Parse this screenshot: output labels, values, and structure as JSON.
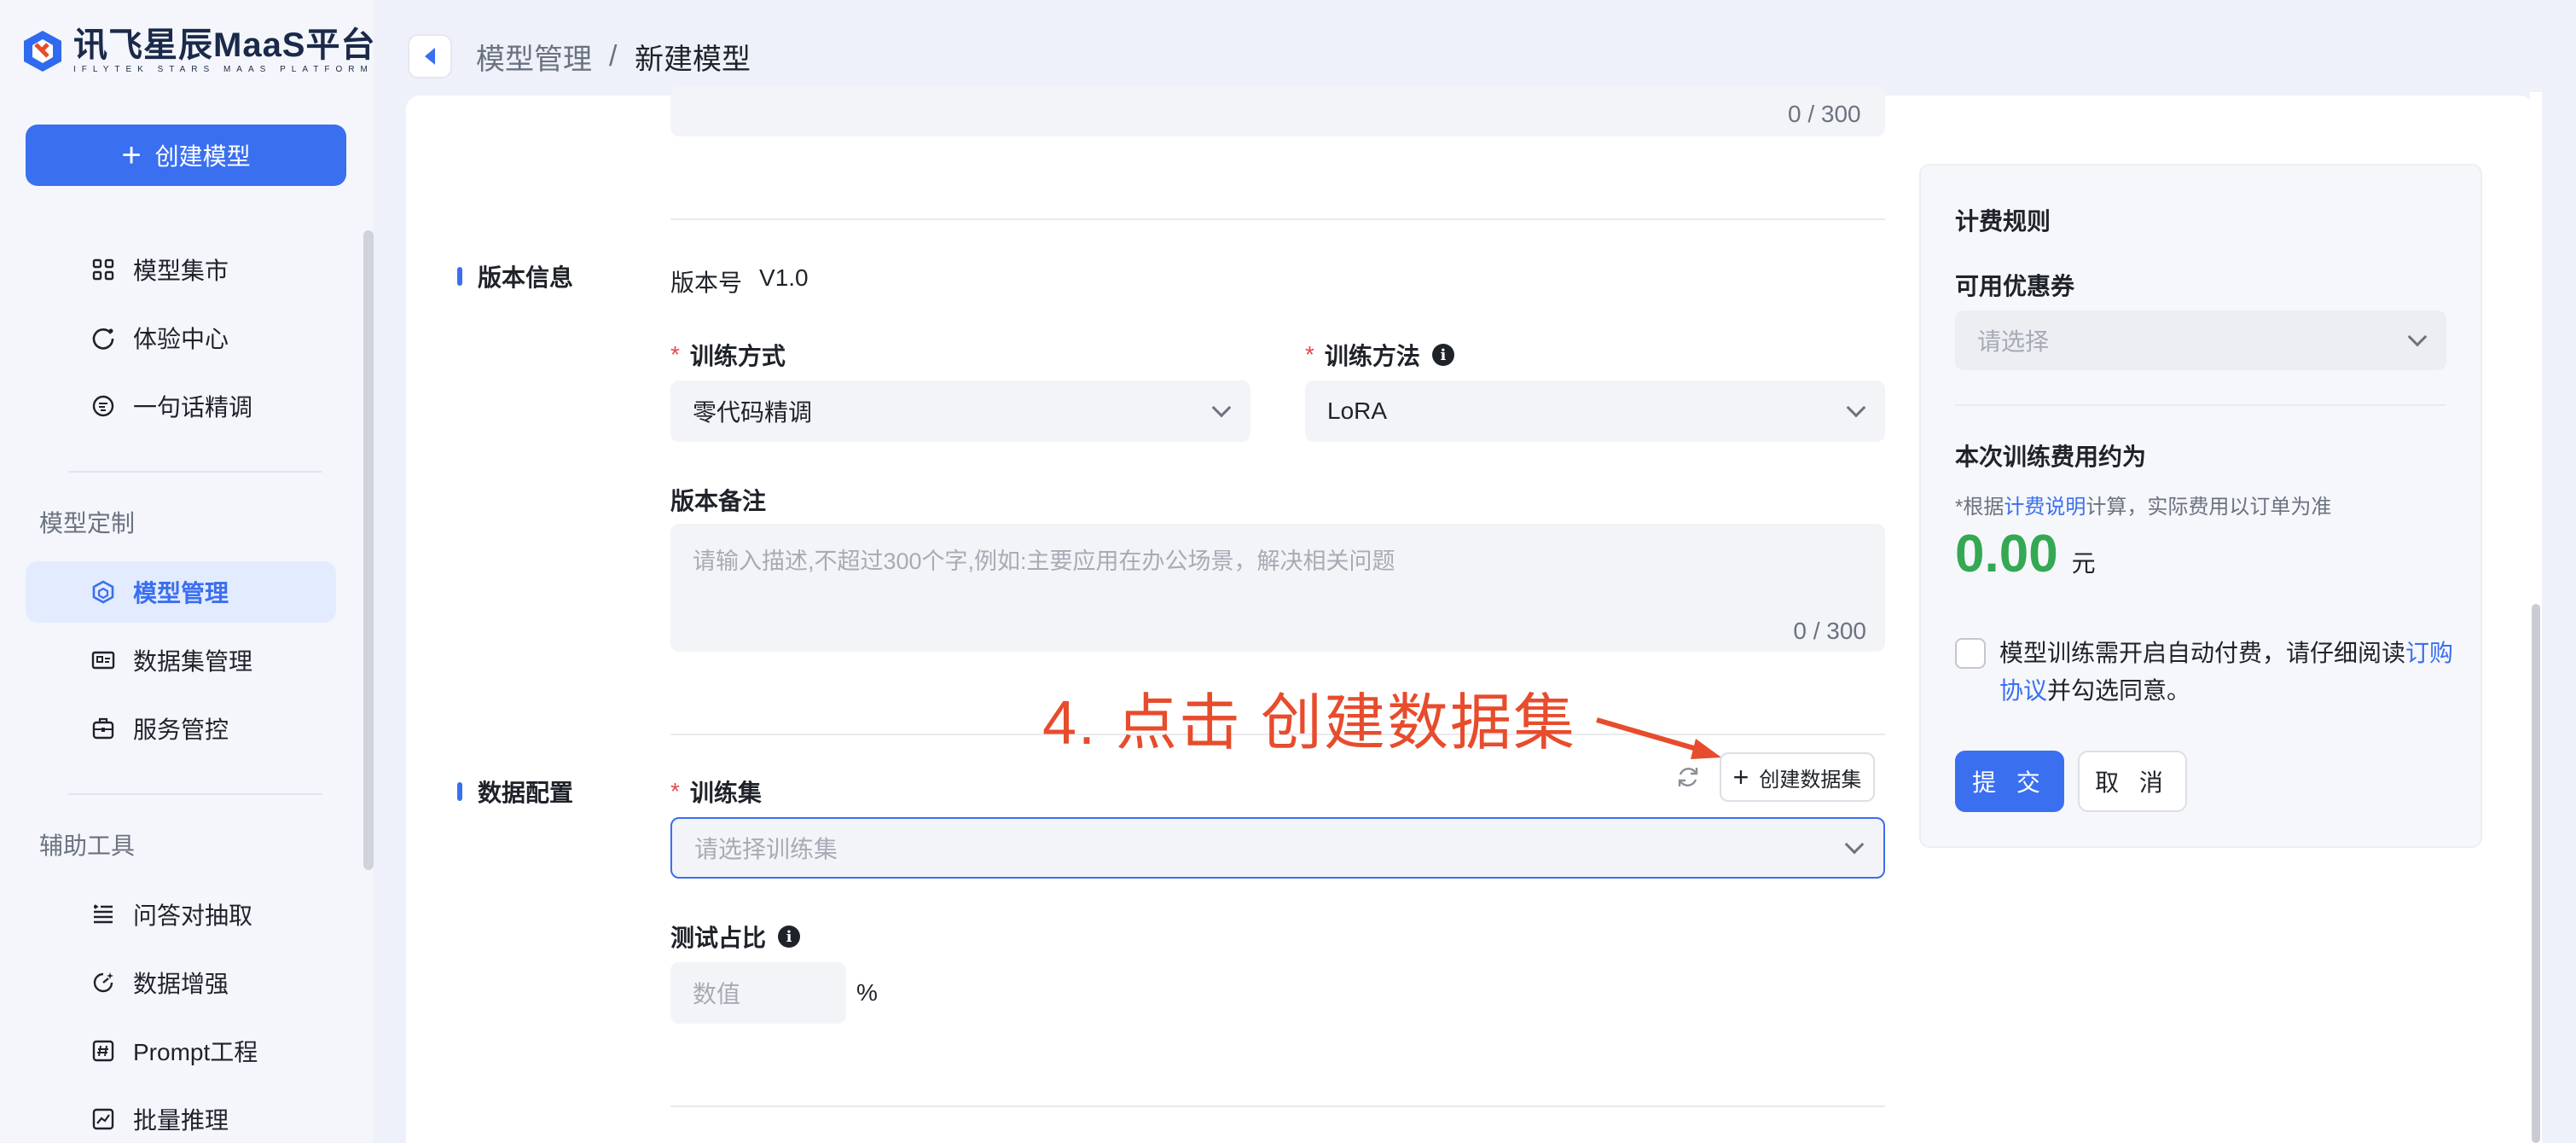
{
  "brand": {
    "title": "讯飞星辰MaaS平台",
    "subtitle": "IFLYTEK STARS MAAS PLATFORM"
  },
  "sidebar": {
    "create_button": "创建模型",
    "items_top": [
      {
        "label": "模型集市",
        "icon": "grid-icon"
      },
      {
        "label": "体验中心",
        "icon": "refresh-circle-icon"
      },
      {
        "label": "一句话精调",
        "icon": "chat-bubble-icon"
      }
    ],
    "section_custom": "模型定制",
    "items_custom": [
      {
        "label": "模型管理",
        "icon": "cube-icon",
        "active": true
      },
      {
        "label": "数据集管理",
        "icon": "dataset-icon"
      },
      {
        "label": "服务管控",
        "icon": "robot-icon"
      }
    ],
    "section_tools": "辅助工具",
    "items_tools": [
      {
        "label": "问答对抽取",
        "icon": "list-icon"
      },
      {
        "label": "数据增强",
        "icon": "sparkle-gauge-icon"
      },
      {
        "label": "Prompt工程",
        "icon": "hash-icon"
      },
      {
        "label": "批量推理",
        "icon": "chart-icon"
      }
    ]
  },
  "breadcrumb": {
    "parent": "模型管理",
    "separator": "/",
    "current": "新建模型"
  },
  "form": {
    "top_counter": "0 / 300",
    "version_section": "版本信息",
    "version_label": "版本号",
    "version_value": "V1.0",
    "train_mode_label": "训练方式",
    "train_mode_value": "零代码精调",
    "train_method_label": "训练方法",
    "train_method_value": "LoRA",
    "note_label": "版本备注",
    "note_placeholder": "请输入描述,不超过300个字,例如:主要应用在办公场景，解决相关问题",
    "note_counter": "0 / 300",
    "data_section": "数据配置",
    "trainset_label": "训练集",
    "trainset_placeholder": "请选择训练集",
    "create_dataset_button": "创建数据集",
    "test_ratio_label": "测试占比",
    "test_ratio_placeholder": "数值",
    "test_ratio_unit": "%",
    "required_mark": "*"
  },
  "annotation": "4. 点击 创建数据集",
  "billing": {
    "title": "计费规则",
    "coupon_label": "可用优惠券",
    "coupon_placeholder": "请选择",
    "fee_title": "本次训练费用约为",
    "fee_note_prefix": "*根据",
    "fee_note_link": "计费说明",
    "fee_note_suffix": "计算，实际费用以订单为准",
    "fee_amount": "0.00",
    "fee_unit": "元",
    "agreement_prefix": "模型训练需开启自动付费，请仔细阅读",
    "agreement_link": "订购协议",
    "agreement_suffix": "并勾选同意。",
    "submit_button": "提 交",
    "cancel_button": "取 消"
  },
  "colors": {
    "primary": "#3a6ff0",
    "price": "#34a853",
    "annotation": "#e74c2c",
    "required": "#e5484d"
  }
}
